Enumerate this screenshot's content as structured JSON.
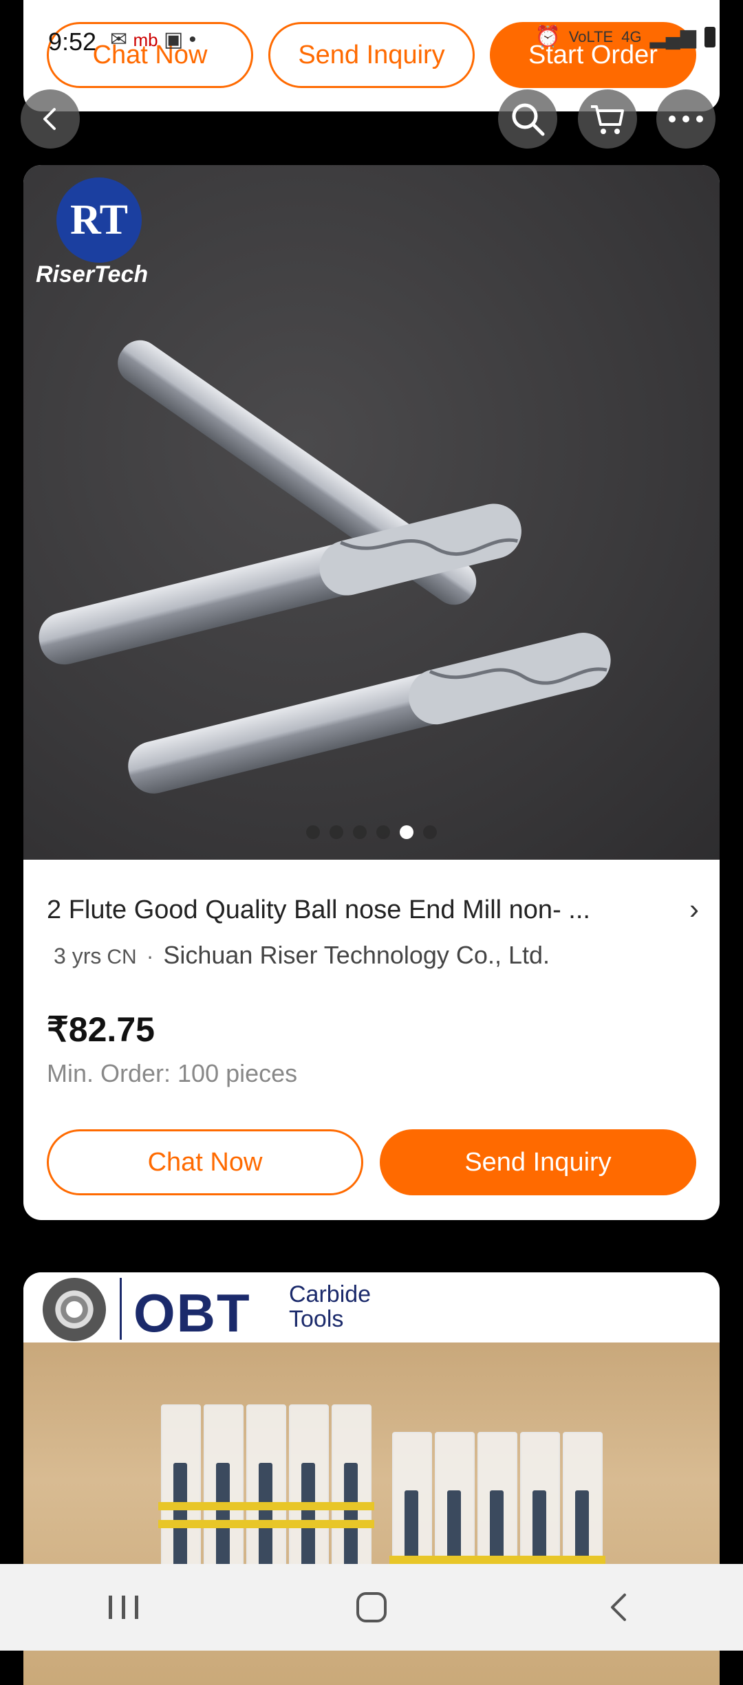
{
  "status": {
    "time": "9:52",
    "carrier_mark": "mb",
    "network": "4G",
    "volte": "VoLTE"
  },
  "top_bar": {
    "chat": "Chat Now",
    "inquiry": "Send Inquiry",
    "order": "Start Order"
  },
  "product": {
    "title": "2 Flute Good Quality Ball nose End Mill non- ...",
    "years": "3 yrs",
    "country": "CN",
    "separator": "·",
    "supplier": "Sichuan Riser Technology Co., Ltd.",
    "price": "₹82.75",
    "min_order": "Min. Order: 100 pieces",
    "image_logo": "RiserTech",
    "carousel": {
      "count": 6,
      "active": 5
    },
    "chat_label": "Chat Now",
    "inquiry_label": "Send Inquiry"
  },
  "next_card": {
    "brand": "OBT",
    "brand_line1": "Carbide",
    "brand_line2": "Tools"
  },
  "colors": {
    "accent": "#ff6a00",
    "brand_navy": "#1b2a6b"
  }
}
